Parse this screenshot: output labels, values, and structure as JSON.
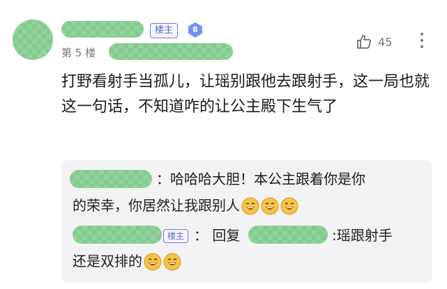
{
  "post": {
    "owner_badge": "楼主",
    "level": "8",
    "floor": "第 5 楼",
    "like_count": "45",
    "content": "打野看射手当孤儿，让瑶别跟他去跟射手，这一局也就这一句话，不知道咋的让公主殿下生气了"
  },
  "replies": [
    {
      "line1": "：哈哈哈大胆！本公主跟着你是你",
      "line2": "的荣幸，你居然让我跟别人",
      "emoji_count": 3
    },
    {
      "owner_badge": "楼主",
      "prefix": "： 回复",
      "suffix": ":瑶跟射手",
      "line2": "还是双排的",
      "emoji_count": 2
    }
  ],
  "colors": {
    "accent": "#5a68cc",
    "level_badge": "#6f95f2",
    "mosaic": "#8fd49a",
    "reply_bg": "#f3f3f5"
  },
  "icons": {
    "like": "thumbs-up-icon",
    "more": "more-vertical-icon",
    "emoji": "grinning-face-icon"
  }
}
